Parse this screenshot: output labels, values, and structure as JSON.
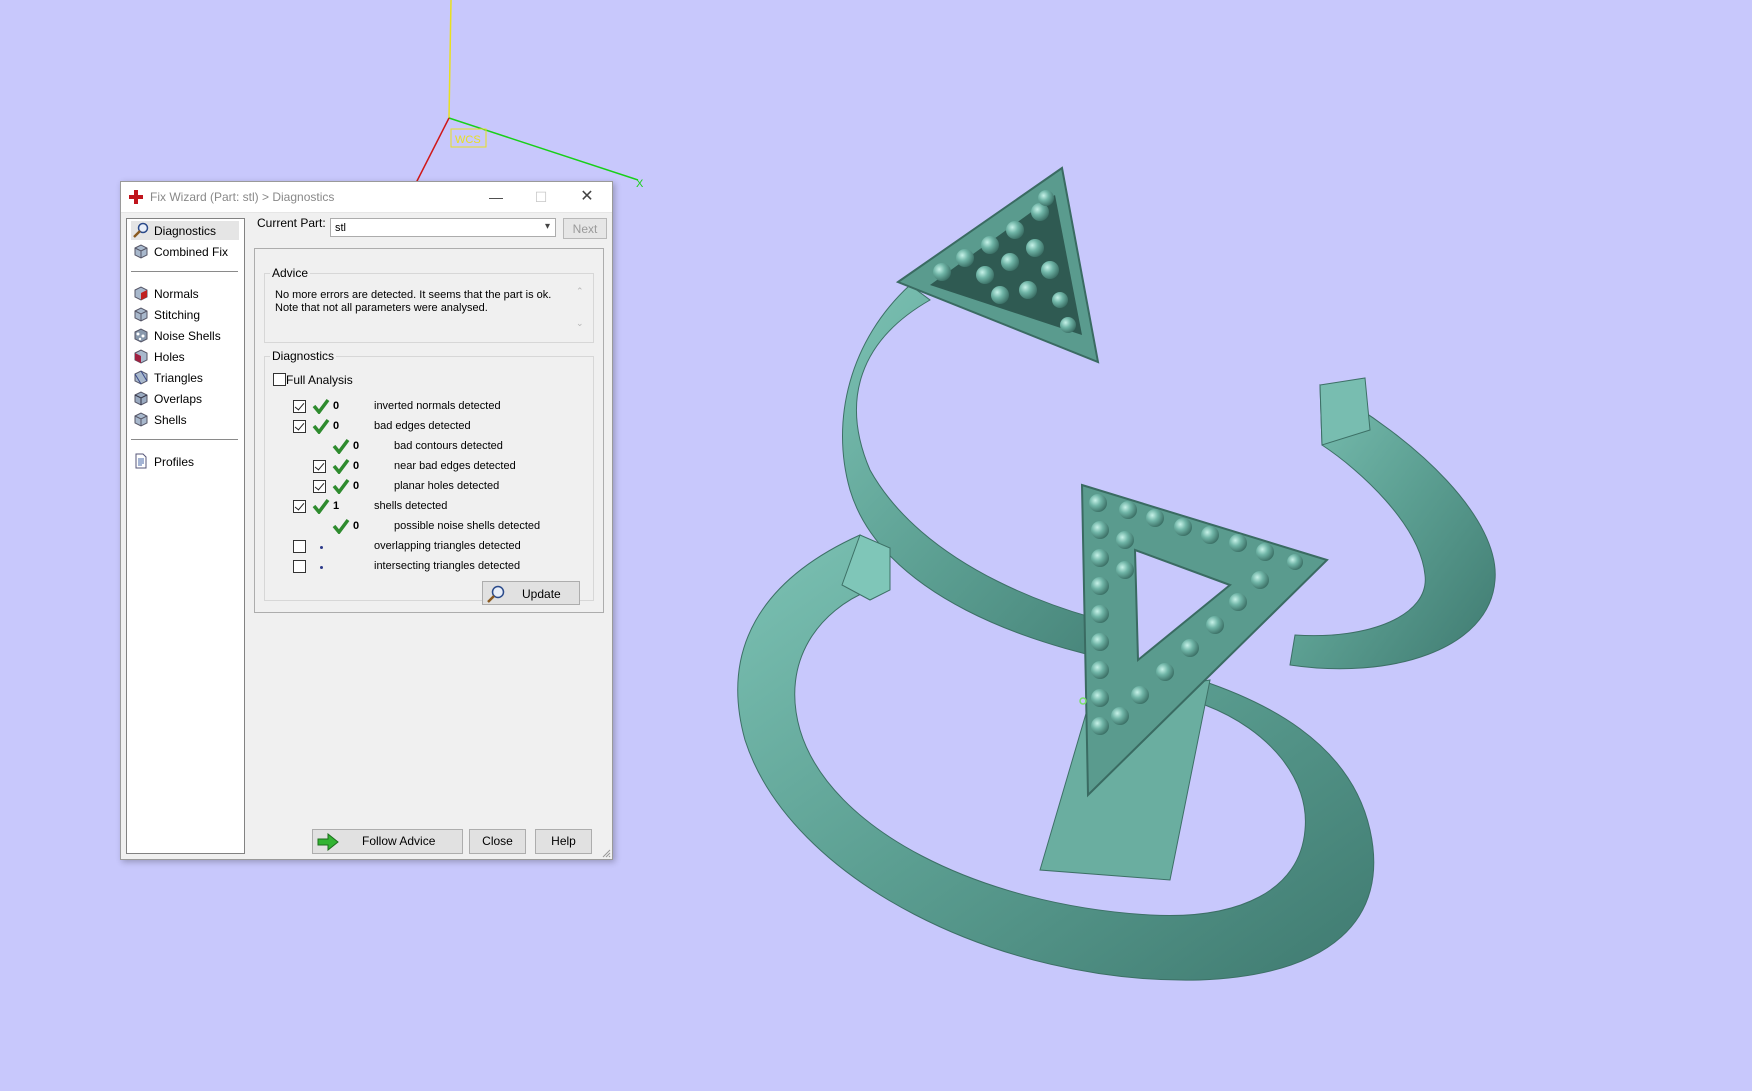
{
  "viewport": {
    "background": "#c8c8fc",
    "axis_label": "WCS",
    "x_axis_label": "X"
  },
  "dialog": {
    "title": "Fix Wizard (Part: stl) > Diagnostics",
    "window_controls": {
      "minimize": "—",
      "maximize": "☐",
      "close": "✕"
    }
  },
  "sidebar": {
    "items": [
      {
        "label": "Diagnostics",
        "icon": "magnifier-icon",
        "selected": true
      },
      {
        "label": "Combined Fix",
        "icon": "cube-icon"
      },
      {
        "label": "Normals",
        "icon": "normals-cube-icon"
      },
      {
        "label": "Stitching",
        "icon": "stitching-cube-icon"
      },
      {
        "label": "Noise Shells",
        "icon": "noise-shells-icon"
      },
      {
        "label": "Holes",
        "icon": "holes-cube-icon"
      },
      {
        "label": "Triangles",
        "icon": "triangles-cube-icon"
      },
      {
        "label": "Overlaps",
        "icon": "overlaps-cube-icon"
      },
      {
        "label": "Shells",
        "icon": "shells-cube-icon"
      },
      {
        "label": "Profiles",
        "icon": "profiles-document-icon"
      }
    ]
  },
  "current_part": {
    "label": "Current Part:",
    "value": "stl",
    "next_label": "Next"
  },
  "advice": {
    "title": "Advice",
    "text_line1": "No more errors are detected. It seems that the part is ok.",
    "text_line2": "Note that not all parameters were analysed."
  },
  "diagnostics": {
    "title": "Diagnostics",
    "full_analysis_label": "Full Analysis",
    "full_analysis_checked": false,
    "rows": [
      {
        "checkbox": true,
        "checked": true,
        "status": "ok",
        "count": "0",
        "label": "inverted normals detected",
        "indent": 0
      },
      {
        "checkbox": true,
        "checked": true,
        "status": "ok",
        "count": "0",
        "label": "bad edges detected",
        "indent": 0
      },
      {
        "checkbox": false,
        "checked": false,
        "status": "ok",
        "count": "0",
        "label": "bad contours detected",
        "indent": 1
      },
      {
        "checkbox": true,
        "checked": true,
        "status": "ok",
        "count": "0",
        "label": "near bad edges detected",
        "indent": 1
      },
      {
        "checkbox": true,
        "checked": true,
        "status": "ok",
        "count": "0",
        "label": "planar holes detected",
        "indent": 1
      },
      {
        "checkbox": true,
        "checked": true,
        "status": "ok",
        "count": "1",
        "label": "shells detected",
        "indent": 0
      },
      {
        "checkbox": false,
        "checked": false,
        "status": "ok",
        "count": "0",
        "label": "possible noise shells detected",
        "indent": 1
      },
      {
        "checkbox": true,
        "checked": false,
        "status": "none",
        "count": "",
        "label": "overlapping triangles detected",
        "indent": 0
      },
      {
        "checkbox": true,
        "checked": false,
        "status": "none",
        "count": "",
        "label": "intersecting triangles detected",
        "indent": 0
      }
    ],
    "update_label": "Update"
  },
  "footer": {
    "follow_advice_label": "Follow Advice",
    "close_label": "Close",
    "help_label": "Help"
  },
  "colors": {
    "model": "#5fa396",
    "check_green": "#2e8b2e",
    "accent_red": "#c0141c"
  }
}
